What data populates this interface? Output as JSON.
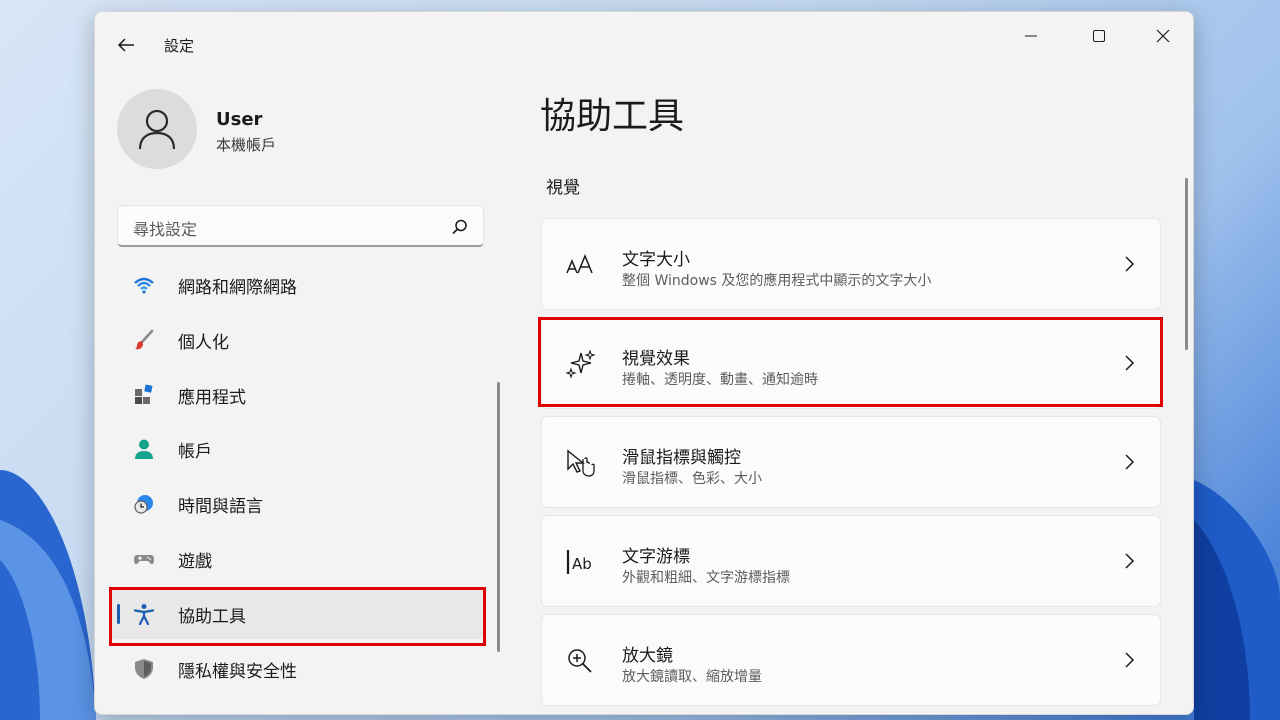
{
  "window": {
    "title": "設定"
  },
  "user": {
    "name": "User",
    "account_type": "本機帳戶"
  },
  "search": {
    "placeholder": "尋找設定"
  },
  "nav": {
    "items": [
      {
        "label": "網路和網際網路",
        "icon": "wifi-icon"
      },
      {
        "label": "個人化",
        "icon": "brush-icon"
      },
      {
        "label": "應用程式",
        "icon": "apps-icon"
      },
      {
        "label": "帳戶",
        "icon": "person-icon"
      },
      {
        "label": "時間與語言",
        "icon": "globe-clock-icon"
      },
      {
        "label": "遊戲",
        "icon": "gamepad-icon"
      },
      {
        "label": "協助工具",
        "icon": "accessibility-icon",
        "selected": true
      },
      {
        "label": "隱私權與安全性",
        "icon": "shield-icon"
      }
    ]
  },
  "main": {
    "title": "協助工具",
    "section": "視覺",
    "cards": [
      {
        "title": "文字大小",
        "subtitle": "整個 Windows 及您的應用程式中顯示的文字大小",
        "icon": "text-size-icon"
      },
      {
        "title": "視覺效果",
        "subtitle": "捲軸、透明度、動畫、通知逾時",
        "icon": "sparkle-icon",
        "highlighted": true
      },
      {
        "title": "滑鼠指標與觸控",
        "subtitle": "滑鼠指標、色彩、大小",
        "icon": "pointer-touch-icon"
      },
      {
        "title": "文字游標",
        "subtitle": "外觀和粗細、文字游標指標",
        "icon": "text-cursor-icon"
      },
      {
        "title": "放大鏡",
        "subtitle": "放大鏡讀取、縮放增量",
        "icon": "magnifier-icon"
      }
    ]
  },
  "colors": {
    "accent": "#1a5fb4",
    "highlight_box": "#e00000"
  }
}
